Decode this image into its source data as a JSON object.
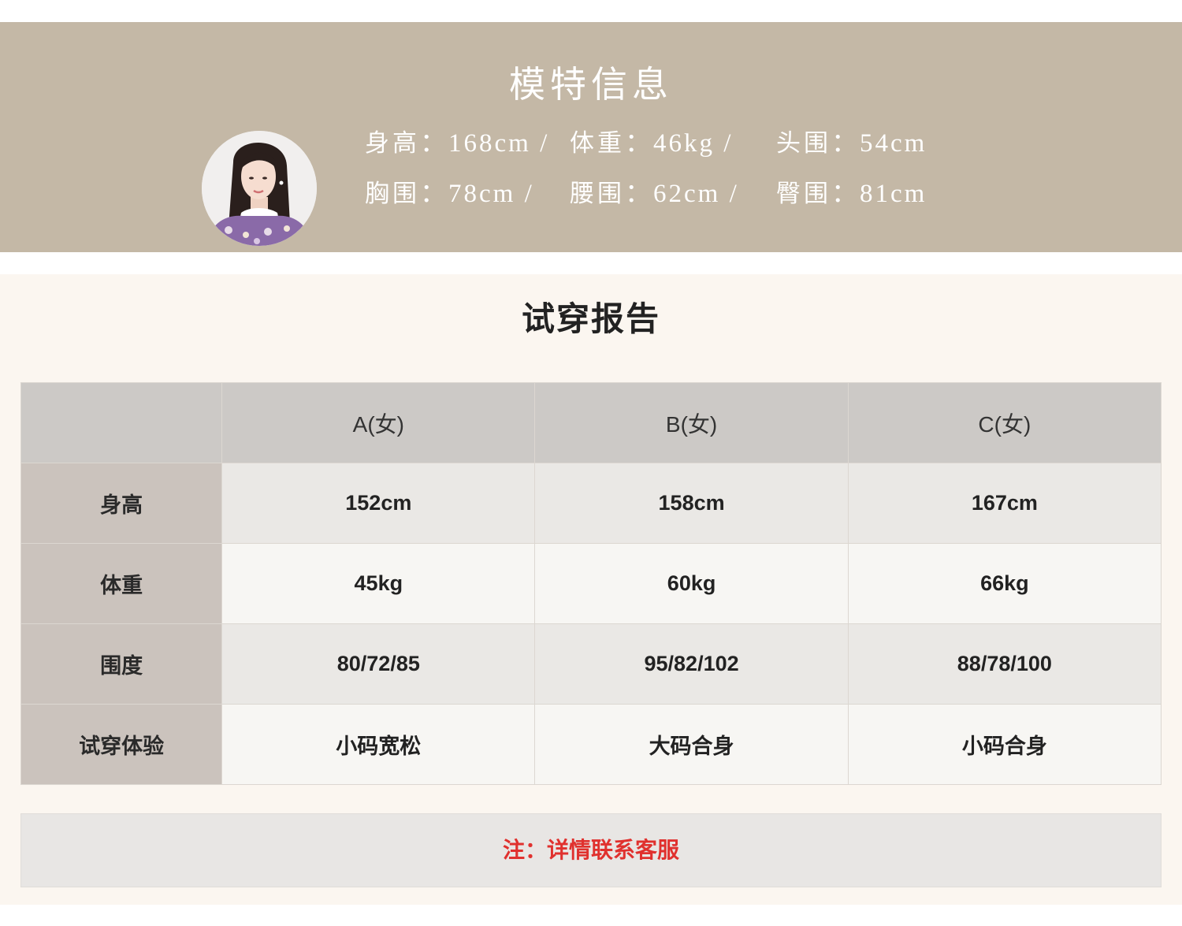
{
  "model_info": {
    "title": "模特信息",
    "measurements": [
      {
        "label": "身高",
        "sep": "：",
        "value": "168cm /"
      },
      {
        "label": "体重",
        "sep": "：",
        "value": "46kg /"
      },
      {
        "label": "头围",
        "sep": "：",
        "value": "54cm"
      },
      {
        "label": "胸围",
        "sep": "：",
        "value": "78cm /"
      },
      {
        "label": "腰围",
        "sep": "：",
        "value": "62cm /"
      },
      {
        "label": "臀围",
        "sep": "：",
        "value": "81cm"
      }
    ]
  },
  "report": {
    "title": "试穿报告",
    "columns": [
      "",
      "A(女)",
      "B(女)",
      "C(女)"
    ],
    "rows": [
      {
        "label": "身高",
        "values": [
          "152cm",
          "158cm",
          "167cm"
        ]
      },
      {
        "label": "体重",
        "values": [
          "45kg",
          "60kg",
          "66kg"
        ]
      },
      {
        "label": "围度",
        "values": [
          "80/72/85",
          "95/82/102",
          "88/78/100"
        ]
      },
      {
        "label": "试穿体验",
        "values": [
          "小码宽松",
          "大码合身",
          "小码合身"
        ]
      }
    ],
    "note": "注：详情联系客服"
  },
  "colors": {
    "band_bg": "#c4b8a6",
    "section_bg": "#fbf6f0",
    "note_text": "#e0312e"
  }
}
